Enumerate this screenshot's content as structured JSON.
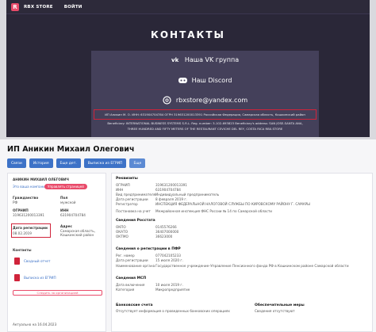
{
  "top": {
    "brand": "RBX STORE",
    "nav_login": "ВОЙТИ",
    "title": "КОНТАКТЫ",
    "links": [
      {
        "icon": "vk-icon",
        "label": "Наша VK группа"
      },
      {
        "icon": "discord-icon",
        "label": "Наш Discord"
      },
      {
        "icon": "email-icon",
        "label": "rbxstore@yandex.com"
      }
    ],
    "legal_line1": "ИП Аникин М. О. ИНН: 631904704784 ОГРН 319631200013391 Российская Федерация, Самарская область, Кошкинский район",
    "legal_line2": "Beneficiary: INTERNATIONAL BUSINESS SYSTEMS S.R.L. Reg. number: 3-102-693823 Beneficiary's address: SAN JOSE-SANTA ANA,",
    "legal_line3": "THREE HUNDRED AND FIFTY METERS OF THE RESTAURANT CEVICHE DEL REY, COSTA RICA RBX.STORE"
  },
  "bottom": {
    "title": "ИП Аникин Михаил Олегович",
    "buttons": [
      "Связи",
      "История",
      "Еще дет.",
      "Выписка из ЕГРИП",
      "Еще"
    ],
    "left": {
      "name": "АНИКИН МИХАИЛ ОЛЕГОВИЧ",
      "status_q": "Это ваша компания?",
      "manage": "Управлять страницей",
      "citizenship_lbl": "Гражданство",
      "citizenship_val": "РФ",
      "gender_lbl": "Пол",
      "gender_val": "мужской",
      "ogrnip_lbl": "ОГРНИП",
      "ogrnip_val": "319631200013391",
      "inn_lbl": "ИНН",
      "inn_val": "631904704784",
      "date_lbl": "Дата регистрации",
      "date_val": "08.02.2019",
      "addr_lbl": "Адрес",
      "addr_val": "Самарская область, Кошкинский район",
      "contacts": "Контакты",
      "doc1": "Сводный отчет",
      "doc2": "Выписка из ЕГРИП",
      "watch": "Следить за организацией",
      "updated": "Актуально на 16.04.2023"
    },
    "right": {
      "requisites": "Реквизиты",
      "rows": [
        [
          "ОГРНИП",
          "319631200013391"
        ],
        [
          "ИНН",
          "631904704784"
        ],
        [
          "Вид предпринимателя",
          "Индивидуальный предприниматель"
        ],
        [
          "Дата регистрации",
          "8 февраля 2019 г."
        ],
        [
          "Регистратор",
          "ИНСПЕКЦИЯ ФЕДЕРАЛЬНОЙ НАЛОГОВОЙ СЛУЖБЫ ПО КИРОВСКОМУ РАЙОНУ Г. САМАРЫ"
        ],
        [
          "Постановка на учет",
          "Межрайонная инспекция ФНС России № 14 по Самарской области"
        ]
      ],
      "stat_title": "Сведения Росстата",
      "stat_rows": [
        [
          "ОКПО",
          "0145576266"
        ],
        [
          "ОКАТО",
          "36407000000"
        ],
        [
          "ОКТМО",
          "36623000"
        ]
      ],
      "pf_title": "Сведения о регистрации в ПФР",
      "pf_rows": [
        [
          "Рег. номер",
          "077042105233"
        ],
        [
          "Дата регистрации",
          "15 июля 2020 г."
        ],
        [
          "Наименование органа",
          "Государственное учреждение–Управление Пенсионного фонда РФ в Кошкинском районе Самарской области"
        ]
      ],
      "msp_title": "Сведения МСП",
      "msp_rows": [
        [
          "Дата включения",
          "10 июля 2019 г."
        ],
        [
          "Категория",
          "Микропредприятие"
        ]
      ],
      "bank_title": "Банковские счета",
      "bank_note": "Отсутствует информация о проведенных банковских операциях",
      "measures_title": "Обеспечительные меры",
      "measures_note": "Сведения отсутствуют"
    }
  }
}
